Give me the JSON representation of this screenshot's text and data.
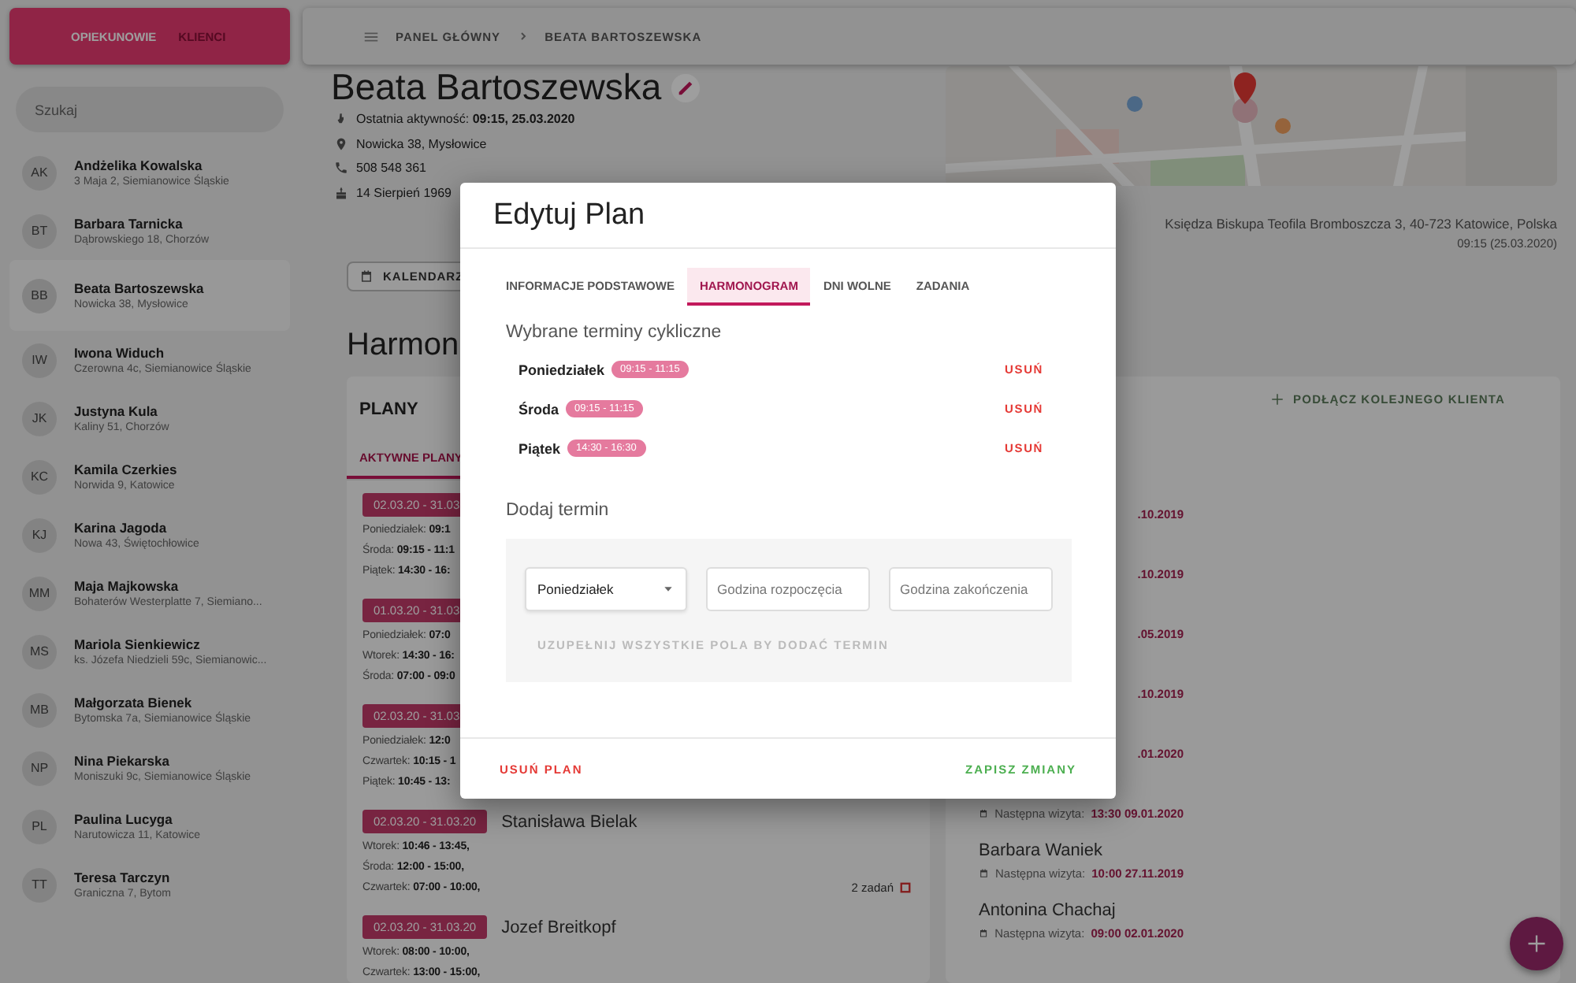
{
  "sidebar": {
    "tabs": [
      {
        "label": "OPIEKUNOWIE",
        "selected": true
      },
      {
        "label": "KLIENCI",
        "selected": false
      }
    ],
    "search": {
      "placeholder": "Szukaj"
    },
    "clients": [
      {
        "initials": "AK",
        "name": "Andżelika Kowalska",
        "address": "3 Maja 2, Siemianowice Śląskie",
        "selected": false
      },
      {
        "initials": "BT",
        "name": "Barbara Tarnicka",
        "address": "Dąbrowskiego 18, Chorzów",
        "selected": false
      },
      {
        "initials": "BB",
        "name": "Beata Bartoszewska",
        "address": "Nowicka 38, Mysłowice",
        "selected": true
      },
      {
        "initials": "IW",
        "name": "Iwona Widuch",
        "address": "Czerowna 4c, Siemianowice Śląskie",
        "selected": false
      },
      {
        "initials": "JK",
        "name": "Justyna Kula",
        "address": "Kaliny 51, Chorzów",
        "selected": false
      },
      {
        "initials": "KC",
        "name": "Kamila Czerkies",
        "address": "Norwida 9, Katowice",
        "selected": false
      },
      {
        "initials": "KJ",
        "name": "Karina Jagoda",
        "address": "Nowa 43, Świętochłowice",
        "selected": false
      },
      {
        "initials": "MM",
        "name": "Maja Majkowska",
        "address": "Bohaterów Westerplatte 7, Siemiano...",
        "selected": false
      },
      {
        "initials": "MS",
        "name": "Mariola Sienkiewicz",
        "address": "ks. Józefa Niedzieli 59c, Siemianowic...",
        "selected": false
      },
      {
        "initials": "MB",
        "name": "Małgorzata Bienek",
        "address": "Bytomska 7a, Siemianowice Śląskie",
        "selected": false
      },
      {
        "initials": "NP",
        "name": "Nina Piekarska",
        "address": "Moniszuki 9c, Siemianowice Śląskie",
        "selected": false
      },
      {
        "initials": "PL",
        "name": "Paulina Lucyga",
        "address": "Narutowicza 11, Katowice",
        "selected": false
      },
      {
        "initials": "TT",
        "name": "Teresa Tarczyn",
        "address": "Graniczna 7, Bytom",
        "selected": false
      }
    ]
  },
  "top_bar": {
    "breadcrumb": [
      "PANEL GŁÓWNY",
      "BEATA BARTOSZEWSKA"
    ]
  },
  "profile": {
    "name": "Beata Bartoszewska",
    "details": [
      {
        "kind": "activity",
        "text": "Ostatnia aktywność: **09:15, 25.03.2020**"
      },
      {
        "kind": "address",
        "text": "Nowicka 38, Mysłowice"
      },
      {
        "kind": "phone",
        "text": "508 548 361"
      },
      {
        "kind": "birthday",
        "text": "14 Sierpień 1969"
      }
    ],
    "location": {
      "kind": "picture",
      "address": "Księdza Biskupa Teofila Bromboszcza 3, 40-723 Katowice, Polska",
      "time": "09:15 (25.03.2020)"
    }
  },
  "calendar_button": "KALENDARZ",
  "schedule_heading": "Harmon",
  "plans_panel": {
    "title": "PLANY",
    "tabs": [
      {
        "label": "AKTYWNE PLANY",
        "selected": true
      }
    ],
    "plans": [
      {
        "dates": "02.03.20 - 31.03",
        "lines": [
          "Poniedziałek: **09:1**",
          "Środa: **09:15 - 11:1**",
          "Piątek: **14:30 - 16:**"
        ]
      },
      {
        "dates": "01.03.20 - 31.03",
        "lines": [
          "Poniedziałek: **07:0**",
          "Wtorek: **14:30 - 16:**",
          "Środa: **07:00 - 09:0**"
        ]
      },
      {
        "dates": "02.03.20 - 31.03",
        "lines": [
          "Poniedziałek: **12:0**",
          "Czwartek: **10:15 - 1**",
          "Piątek: **10:45 - 13:**"
        ]
      },
      {
        "dates": "02.03.20 - 31.03.20",
        "client": "Stanisława Bielak",
        "lines": [
          "Wtorek: **10:46 - 13:45,**",
          "Środa: **12:00 - 15:00,**",
          "Czwartek: **07:00 - 10:00,**"
        ],
        "tasks": "2 zadań"
      },
      {
        "dates": "02.03.20 - 31.03.20",
        "client": "Jozef Breitkopf",
        "lines": [
          "Wtorek: **08:00 - 10:00,**",
          "Czwartek: **13:00 - 15:00,**"
        ]
      }
    ]
  },
  "clients_panel": {
    "add_button": "PODŁĄCZ KOLEJNEGO KLIENTA",
    "entries": [
      {
        "kind": "fragment",
        "value": ".10.2019"
      },
      {
        "kind": "fragment",
        "value": ".10.2019"
      },
      {
        "kind": "fragment",
        "value": ".05.2019"
      },
      {
        "kind": "fragment",
        "value": ".10.2019"
      },
      {
        "kind": "fragment",
        "value": ".01.2020"
      },
      {
        "kind": "visit",
        "label": "Następna wizyta:",
        "value": "13:30 09.01.2020"
      },
      {
        "kind": "client",
        "name": "Barbara Waniek",
        "label": "Następna wizyta:",
        "value": "10:00 27.11.2019"
      },
      {
        "kind": "client",
        "name": "Antonina Chachaj",
        "label": "Następna wizyta:",
        "value": "09:00 02.01.2020"
      }
    ]
  },
  "dialog": {
    "title": "Edytuj Plan",
    "tabs": [
      {
        "label": "INFORMACJE PODSTAWOWE",
        "selected": false
      },
      {
        "label": "HARMONOGRAM",
        "selected": true
      },
      {
        "label": "DNI WOLNE",
        "selected": false
      },
      {
        "label": "ZADANIA",
        "selected": false
      }
    ],
    "section_title": "Wybrane terminy cykliczne",
    "terms": [
      {
        "day": "Poniedziałek",
        "time": "09:15 - 11:15",
        "action": "USUŃ"
      },
      {
        "day": "Środa",
        "time": "09:15 - 11:15",
        "action": "USUŃ"
      },
      {
        "day": "Piątek",
        "time": "14:30 - 16:30",
        "action": "USUŃ"
      }
    ],
    "add_title": "Dodaj termin",
    "day_select": {
      "value": "Poniedziałek"
    },
    "start_field": {
      "placeholder": "Godzina rozpoczęcia"
    },
    "end_field": {
      "placeholder": "Godzina zakończenia"
    },
    "add_button": {
      "label": "UZUPEŁNIJ WSZYSTKIE POLA BY DODAĆ TERMIN",
      "disabled": true
    },
    "delete_button": "USUŃ PLAN",
    "save_button": "ZAPISZ ZMIANY"
  }
}
